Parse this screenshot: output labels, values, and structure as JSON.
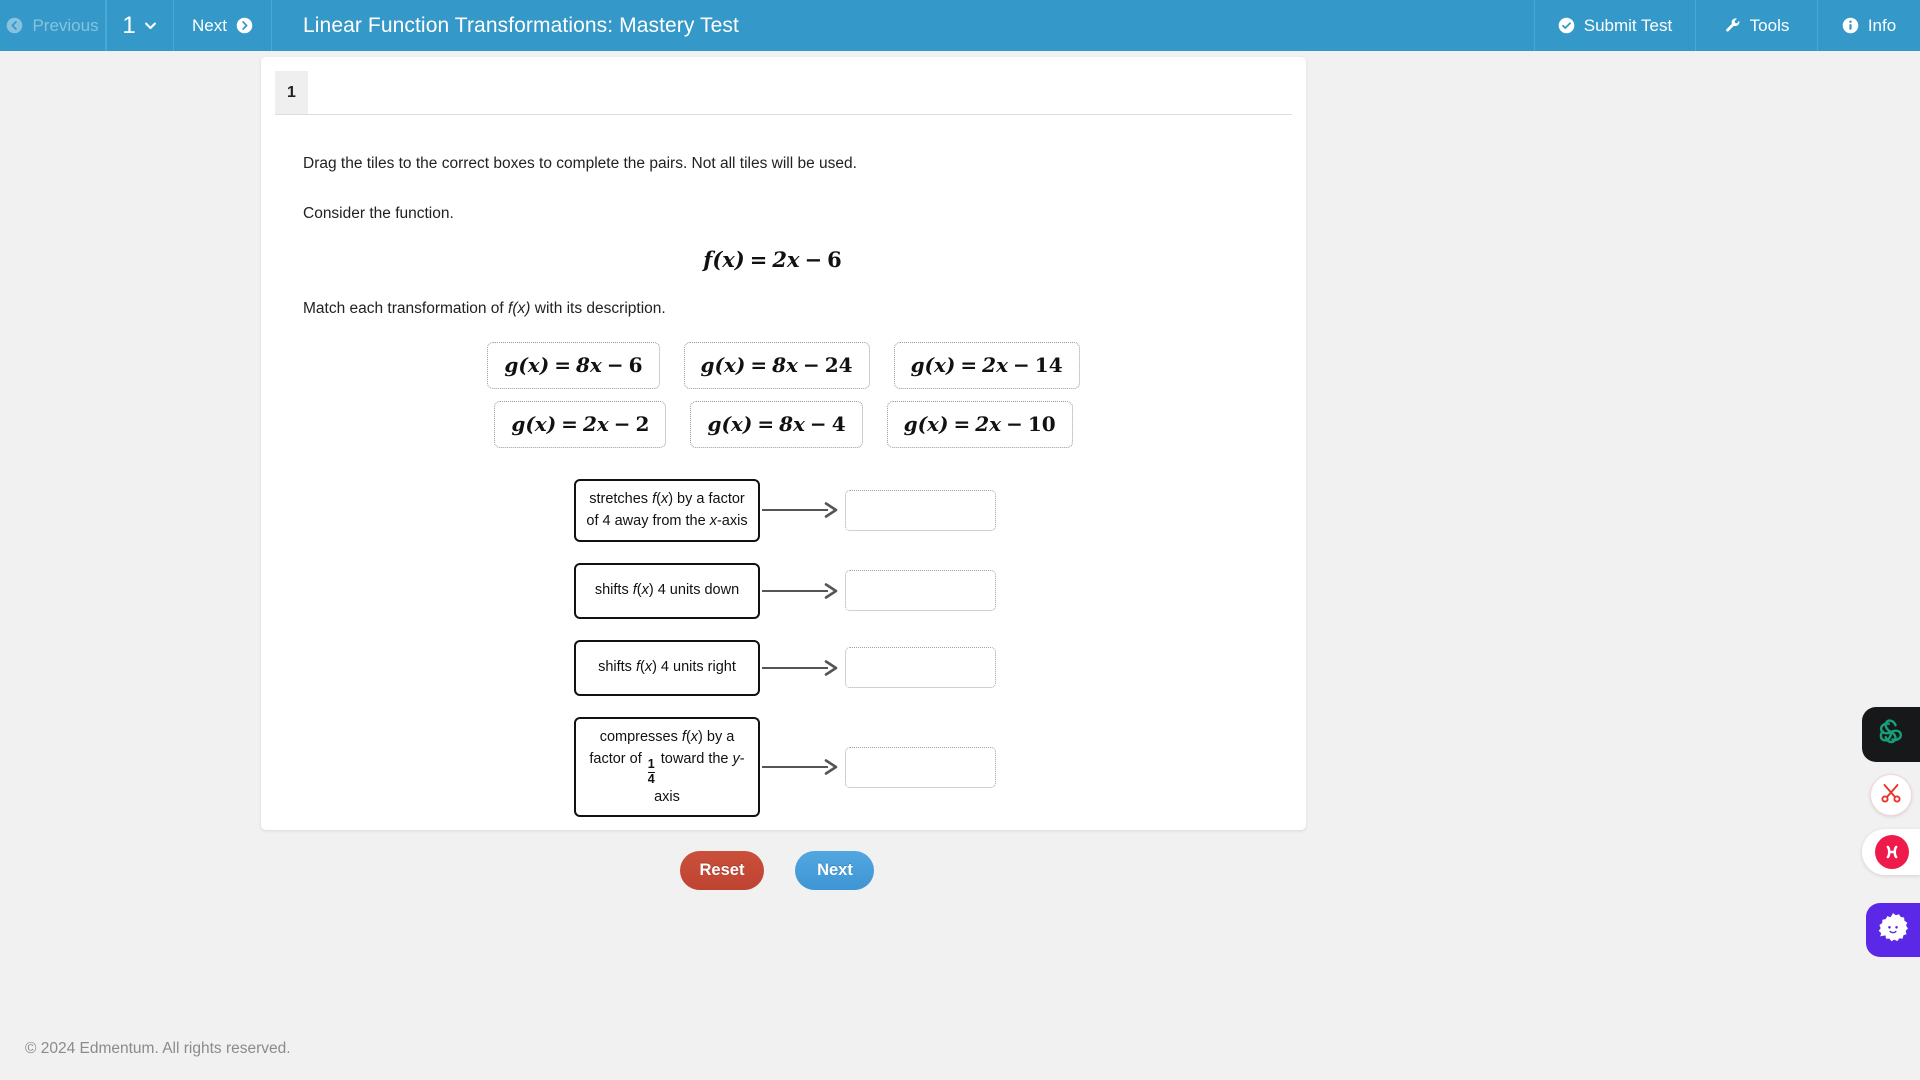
{
  "header": {
    "previous_label": "Previous",
    "page_number": "1",
    "next_label": "Next",
    "title": "Linear Function Transformations: Mastery Test",
    "submit_label": "Submit Test",
    "tools_label": "Tools",
    "info_label": "Info",
    "background_color": "#3498c8",
    "icons": {
      "previous": "circle-arrow-left-icon",
      "page_dropdown": "chevron-down-icon",
      "next": "circle-arrow-right-icon",
      "submit": "circle-check-icon",
      "tools": "wrench-icon",
      "info": "circle-info-icon"
    }
  },
  "question": {
    "number": "1",
    "instruction": "Drag the tiles to the correct boxes to complete the pairs. Not all tiles will be used.",
    "consider_text": "Consider the function.",
    "function_display": {
      "lhs": "f(x)",
      "equals": "=",
      "term": "2x",
      "minus": "−",
      "constant": "6"
    },
    "match_text_parts": {
      "before": "Match each transformation of ",
      "italic": "f(x)",
      "after": " with its description."
    }
  },
  "tiles": [
    {
      "id": "tile-1",
      "lhs": "g(x)",
      "term": "8x",
      "constant": "6"
    },
    {
      "id": "tile-2",
      "lhs": "g(x)",
      "term": "8x",
      "constant": "24"
    },
    {
      "id": "tile-3",
      "lhs": "g(x)",
      "term": "2x",
      "constant": "14"
    },
    {
      "id": "tile-4",
      "lhs": "g(x)",
      "term": "2x",
      "constant": "2"
    },
    {
      "id": "tile-5",
      "lhs": "g(x)",
      "term": "8x",
      "constant": "4"
    },
    {
      "id": "tile-6",
      "lhs": "g(x)",
      "term": "2x",
      "constant": "10"
    }
  ],
  "match_rows": [
    {
      "id": "row-1",
      "description_plain": "stretches f(x) by a factor of 4 away from the x-axis",
      "answer": ""
    },
    {
      "id": "row-2",
      "description_plain": "shifts f(x) 4 units down",
      "answer": ""
    },
    {
      "id": "row-3",
      "description_plain": "shifts f(x) 4 units right",
      "answer": ""
    },
    {
      "id": "row-4",
      "description_plain": "compresses f(x) by a factor of 1/4 toward the y-axis",
      "answer": ""
    }
  ],
  "actions": {
    "reset_label": "Reset",
    "next_label": "Next",
    "reset_color": "#c44a36",
    "next_color": "#459ed8"
  },
  "footer": {
    "copyright": "© 2024 Edmentum. All rights reserved."
  },
  "floating_widgets": [
    {
      "name": "pinwheel-extension",
      "color": "#17181a",
      "accent": "#16a07a"
    },
    {
      "name": "scissors-extension",
      "color": "#ffffff",
      "accent": "#e8332a"
    },
    {
      "name": "cross-badge-extension",
      "color": "#ffffff",
      "accent": "#ef1a4c"
    },
    {
      "name": "gear-face-extension",
      "color": "#5b28e8",
      "accent": "#ffffff"
    }
  ]
}
